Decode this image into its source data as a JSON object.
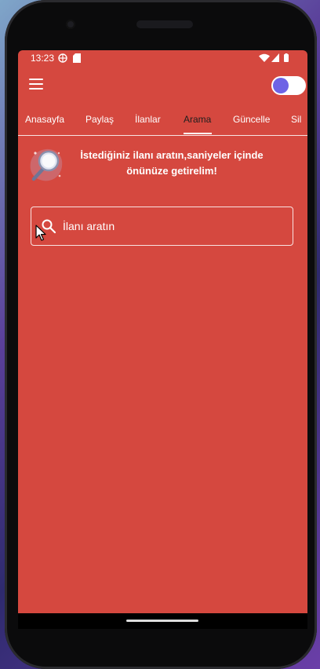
{
  "status": {
    "time": "13:23"
  },
  "appbar": {
    "dark_mode_toggle_on": true
  },
  "tabs": [
    {
      "label": "Anasayfa",
      "active": false
    },
    {
      "label": "Paylaş",
      "active": false
    },
    {
      "label": "İlanlar",
      "active": false
    },
    {
      "label": "Arama",
      "active": true
    },
    {
      "label": "Güncelle",
      "active": false
    },
    {
      "label": "Sil",
      "active": false
    }
  ],
  "banner": {
    "line1": "İstediğiniz ilanı aratın,saniyeler içinde",
    "line2": "önünüze getirelim!"
  },
  "search": {
    "placeholder": "İlanı aratın"
  },
  "colors": {
    "background": "#d5483f",
    "toggle_knob": "#6e63e5",
    "active_tab": "#1e1e1e"
  }
}
